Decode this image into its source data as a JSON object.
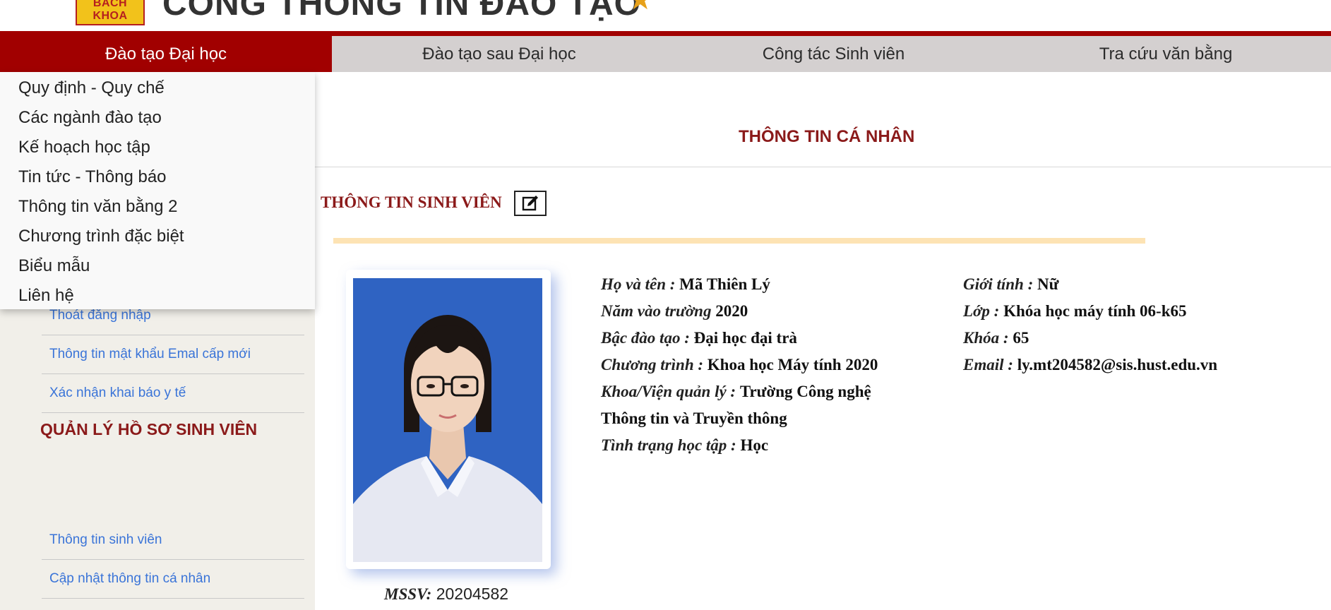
{
  "header": {
    "logo_text": "BÁCH KHOA",
    "portal_title": "CỔNG THÔNG TIN ĐÀO TẠO"
  },
  "nav": {
    "items": [
      "Đào tạo Đại học",
      "Đào tạo sau Đại học",
      "Công tác Sinh viên",
      "Tra cứu văn bằng"
    ],
    "active_color": "#a10000"
  },
  "dropdown": {
    "items": [
      "Quy định - Quy chế",
      "Các ngành đào tạo",
      "Kế hoạch học tập",
      "Tin tức - Thông báo",
      "Thông tin văn bằng 2",
      "Chương trình đặc biệt",
      "Biểu mẫu",
      "Liên hệ"
    ]
  },
  "sidebar": {
    "links": [
      "Thoát đăng nhập",
      "Thông tin mật khẩu Emal cấp mới",
      "Xác nhận khai báo y tế"
    ],
    "section_heading": "QUẢN LÝ HỒ SƠ SINH VIÊN",
    "section_links": [
      "Thông tin sinh viên",
      "Cập nhật thông tin cá nhân"
    ]
  },
  "main": {
    "title": "THÔNG TIN CÁ NHÂN",
    "student_heading": "THÔNG TIN SINH VIÊN",
    "mssv_label": "MSSV:",
    "mssv_value": "20204582"
  },
  "student": {
    "left": [
      {
        "label": "Họ và tên",
        "sep": " :",
        "value": "Mã Thiên Lý"
      },
      {
        "label": "Năm vào trường",
        "sep": "",
        "value": "2020"
      },
      {
        "label": "Bậc đào tạo",
        "sep": " :",
        "value": "Đại học đại trà"
      },
      {
        "label": "Chương trình",
        "sep": " :",
        "value": "Khoa học Máy tính 2020"
      },
      {
        "label": "Khoa/Viện quản lý",
        "sep": " :",
        "value": "Trường Công nghệ"
      },
      {
        "label": "",
        "sep": "",
        "value": "Thông tin và Truyền thông"
      },
      {
        "label": "Tình trạng học tập",
        "sep": " :",
        "value": "Học"
      }
    ],
    "right": [
      {
        "label": "Giới tính",
        "sep": " :",
        "value": "Nữ"
      },
      {
        "label": "Lớp",
        "sep": " :",
        "value": "Khóa học máy tính 06-k65"
      },
      {
        "label": "Khóa",
        "sep": " :",
        "value": "65"
      },
      {
        "label": "Email",
        "sep": " :",
        "value": "ly.mt204582@sis.hust.edu.vn"
      }
    ]
  }
}
